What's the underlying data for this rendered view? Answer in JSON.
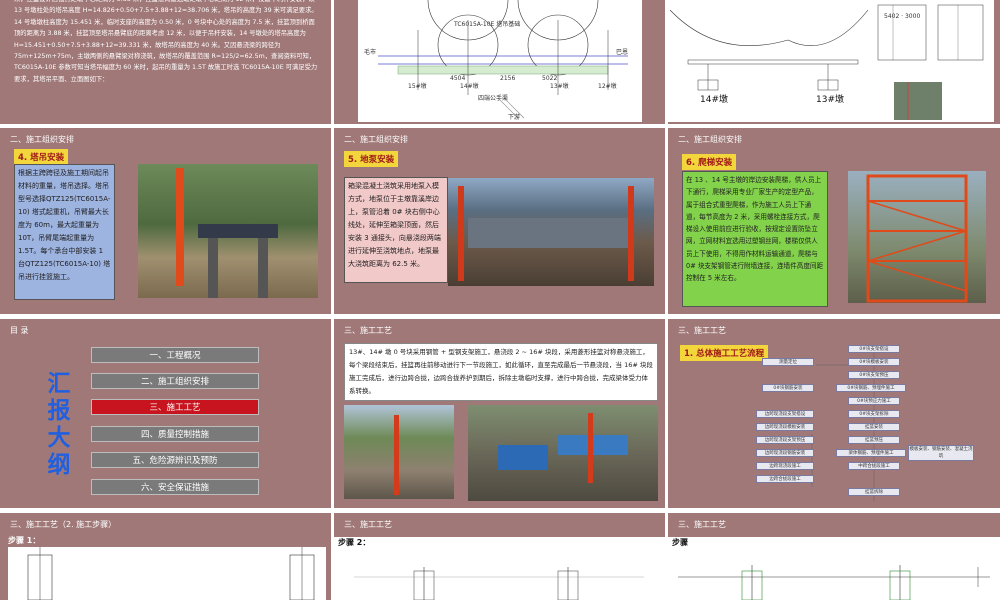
{
  "colors": {
    "slide_bg": "#a07878",
    "tag_bg": "#f2d63b",
    "tag_text": "#a01818",
    "blue_box": "#9db3e0",
    "pink_box": "#f2c9c9",
    "green_box": "#83d24b",
    "menu_gray": "#7a7a7a",
    "menu_active": "#c8141e",
    "title_blue": "#2060e0"
  },
  "s1": {
    "text": "米，挂篮设计后锚点距墩中心距离为 3.88 米，挂篮悬臂最远端距墩中心距离为 12 米，按最不利杆安装，故 13 号墩柱处的塔吊高度 H=14.826+0.50+7.5+3.88+12=38.706 米，塔吊的高度为 39 米可满足要求。14 号墩墩柱高度为 15.451 米，临时支座的高度为 0.50 米，0 号块中心处的高度为 7.5 米，挂篮顶到桥面顶的距离为 3.88 米，挂篮顶至塔吊悬臂底的距离考虑 12 米，以便于吊杆安装，14 号墩处的塔吊高度为 H=15.451+0.50+7.5+3.88+12=39.331 米，故塔吊的高度为 40 米。又因悬浇梁的跨径为 75m+125m+75m，主墩两侧的悬臂梁对称浇筑，故塔吊的覆盖范围 R=125/2=62.5m，查阅资料可知，TC6015A-10E 参数可知当塔吊幅度为 60 米时，起吊的重量为 1.5T 故施工时选 TC6015A-10E 可满足受力要求，其塔吊平面、立面图如下："
  },
  "s2": {
    "crane": "TC6015A-10E\n塔吊基础",
    "left_label": "毛市",
    "right_label": "巴恩",
    "pier1": "15#墩",
    "pier2": "14#墩",
    "pier3": "13#墩",
    "pier4": "12#墩",
    "river": "四端公手渠",
    "down": "下游",
    "d1": "4504",
    "d2": "2156",
    "d3": "5022"
  },
  "s3": {
    "pier_a": "14#墩",
    "pier_b": "13#墩",
    "dims": "5402 · 3000"
  },
  "s4": {
    "section": "二、施工组织安排",
    "tag": "4. 塔吊安装",
    "text": "根据主跨跨径及施工期间起吊材料的重量，塔吊选择。塔吊型号选择QTZ125(TC6015A-10) 塔式起重机，吊臂最大长度为 60m，最大起重量为 10T，吊臂尾端起重量为 1.5T。每个承台中部安装 1 台QTZ125(TC6015A-10) 塔吊进行挂篮施工。"
  },
  "s5": {
    "section": "二、施工组织安排",
    "tag": "5. 地泵安装",
    "text": "箱梁混凝土浇筑采用地泵入模方式，地泵位于主墩靠溪岸边上，泵管沿着 0# 块右侧中心线处，延伸至箱梁顶面，然后安装 3 通接头，向悬浇段两端进行延伸至浇筑地点，地泵最大浇筑距离为 62.5 米。"
  },
  "s6": {
    "section": "二、施工组织安排",
    "tag": "6. 爬梯安装",
    "text": "在 13 、14 号主墩的岸边安装爬梯，供人员上下通行，爬梯采用专业厂家生产的定型产品，属于组合式重型爬梯，作为施工人员上下通道，每节高度为 2 米，采用螺栓连接方式，爬梯设入使用前应进行验收，按规定设置防坠立网，立网材料宜选用过塑钢丝网，楼梯仅供人员上下使用，不得用作材料运输通道，爬梯与 0# 块支架钢管进行附墙连接，连墙件高度间距控制在 5 米左右。"
  },
  "s7": {
    "section": "目 录",
    "title": "汇报大纲",
    "menu": [
      "一、工程概况",
      "二、施工组织安排",
      "三、施工工艺",
      "四、质量控制措施",
      "五、危险源辨识及预防",
      "六、安全保证措施"
    ]
  },
  "s8": {
    "section": "三、施工工艺",
    "text": "13#、14# 墩 0 号块采用钢管 + 型钢支架施工，悬浇段 2 ~ 16# 块段，采用菱形挂篮对称悬浇施工，每个梁段结束后，挂篮再往前移动进行下一节段施工，如此循环，直至完成最后一节悬浇段，当 16# 块段施工完成后，进行边跨合拢，边跨合拢养护到期后，拆除主墩临时支撑，进行中跨合拢，完成梁体受力体系转换。"
  },
  "s9": {
    "section": "三、施工工艺",
    "tag": "1. 总体施工工艺流程",
    "flow": [
      "0#块支架搭设",
      "测量定位",
      "0#块模板安装",
      "0#块支架预压",
      "0#块钢筋安装",
      "0#块钢筋、预埋件施工",
      "0#块预应力施工",
      "边跨现浇段支架搭设",
      "0#块支架拆除",
      "边跨现浇段模板安装",
      "挂篮安装",
      "边跨现浇段支架预压",
      "挂篮预压",
      "边跨现浇段钢筋安装",
      "梁体钢筋、预埋件施工",
      "模板安装、钢筋安装、混凝土浇筑",
      "边跨现浇段施工",
      "中跨合拢段施工",
      "边跨合拢段施工",
      "挂篮拆除"
    ]
  },
  "s10": {
    "section": "三、施工工艺（2. 施工步骤）",
    "step": "步骤 1："
  },
  "s11": {
    "section": "三、施工工艺",
    "step": "步骤 2："
  },
  "s12": {
    "section": "三、施工工艺",
    "step": "步骤"
  }
}
